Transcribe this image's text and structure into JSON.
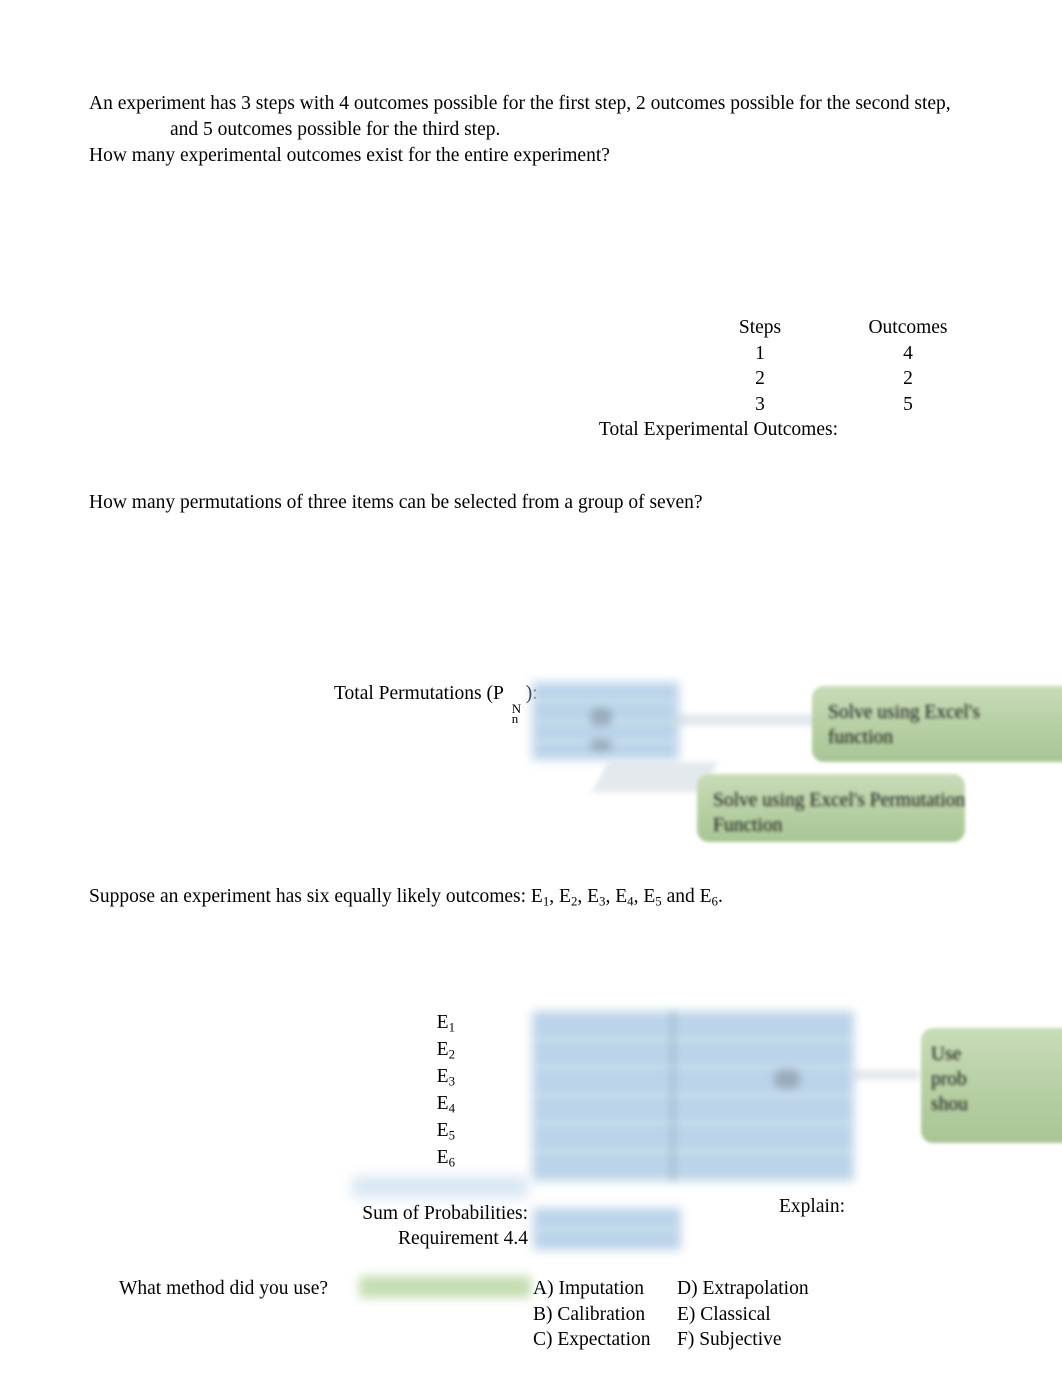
{
  "document": {
    "background_color": "#ffffff",
    "accent_blue": "#b8d2e8",
    "accent_green": "#b6cfa3"
  },
  "problem1": {
    "line1": "An experiment has 3 steps with 4 outcomes possible for the first step, 2 outcomes possible for the second step,",
    "line2": "and 5 outcomes possible for the third step.",
    "line3": "How many experimental outcomes exist for the entire experiment?",
    "table": {
      "headers": [
        "Steps",
        "Outcomes"
      ],
      "rows": [
        [
          "1",
          "4"
        ],
        [
          "2",
          "2"
        ],
        [
          "3",
          "5"
        ]
      ],
      "total_label": "Total Experimental Outcomes:",
      "total_value": ""
    }
  },
  "problem2": {
    "question": "How many permutations of three items can be selected from a group of seven?",
    "total_label_prefix": "Total Permutations (P",
    "total_label_sub": "n",
    "total_label_sup": "N",
    "total_label_suffix": "):",
    "callouts": [
      {
        "name": "excel-function-callout",
        "text": "Solve using Excel's function"
      },
      {
        "name": "excel-permutation-callout",
        "text": "Solve using Excel's Permutation Function"
      }
    ]
  },
  "problem3": {
    "intro_prefix": "Suppose an experiment has six equally likely outcomes: E",
    "intro_outcomes": [
      "1",
      "2",
      "3",
      "4",
      "5",
      "6"
    ],
    "intro_suffix": ".",
    "outcome_labels": [
      "E",
      "E",
      "E",
      "E",
      "E",
      "E"
    ],
    "outcome_subs": [
      "1",
      "2",
      "3",
      "4",
      "5",
      "6"
    ],
    "sum_label": "Sum of Probabilities:",
    "requirement_label": "Requirement 4.4",
    "explain_label": "Explain:",
    "side_callout": "Use prob shou",
    "method_question": "What method did you use?",
    "method_answer": "",
    "choices_left": [
      "A) Imputation",
      "B) Calibration",
      "C) Expectation"
    ],
    "choices_right": [
      "D) Extrapolation",
      "E) Classical",
      "F) Subjective"
    ]
  }
}
